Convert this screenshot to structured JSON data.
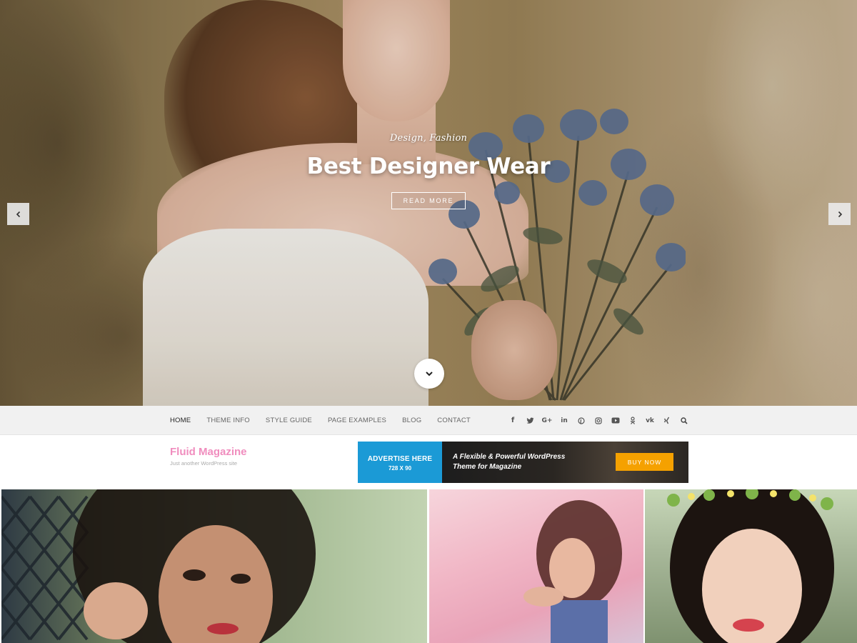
{
  "hero": {
    "categories": "Design, Fashion",
    "title": "Best Designer Wear",
    "button_label": "READ MORE",
    "prev_icon": "chevron-left-icon",
    "next_icon": "chevron-right-icon",
    "scroll_icon": "chevron-down-icon"
  },
  "nav": {
    "items": [
      {
        "label": "HOME",
        "active": true
      },
      {
        "label": "THEME INFO",
        "active": false
      },
      {
        "label": "STYLE GUIDE",
        "active": false
      },
      {
        "label": "PAGE EXAMPLES",
        "active": false
      },
      {
        "label": "BLOG",
        "active": false
      },
      {
        "label": "CONTACT",
        "active": false
      }
    ],
    "social": [
      {
        "icon": "facebook-icon",
        "glyph": "f"
      },
      {
        "icon": "twitter-icon",
        "glyph": "✦"
      },
      {
        "icon": "google-plus-icon",
        "glyph": "G+"
      },
      {
        "icon": "linkedin-icon",
        "glyph": "in"
      },
      {
        "icon": "pinterest-icon",
        "glyph": "℗"
      },
      {
        "icon": "instagram-icon",
        "glyph": "◎"
      },
      {
        "icon": "youtube-icon",
        "glyph": "▶"
      },
      {
        "icon": "odnoklassniki-icon",
        "glyph": "ꝍ"
      },
      {
        "icon": "vk-icon",
        "glyph": "vk"
      },
      {
        "icon": "xing-icon",
        "glyph": "✕"
      },
      {
        "icon": "search-icon",
        "glyph": "⚲"
      }
    ]
  },
  "header": {
    "site_title": "Fluid Magazine",
    "site_description": "Just another WordPress site"
  },
  "ad": {
    "headline": "ADVERTISE HERE",
    "size": "728 X 90",
    "text_line1": "A Flexible & Powerful WordPress",
    "text_line2": "Theme for Magazine",
    "button_label": "BUY NOW"
  },
  "colors": {
    "brand_pink": "#f08dbe",
    "ad_blue": "#1b9ad6",
    "buy_orange": "#f5a100"
  }
}
